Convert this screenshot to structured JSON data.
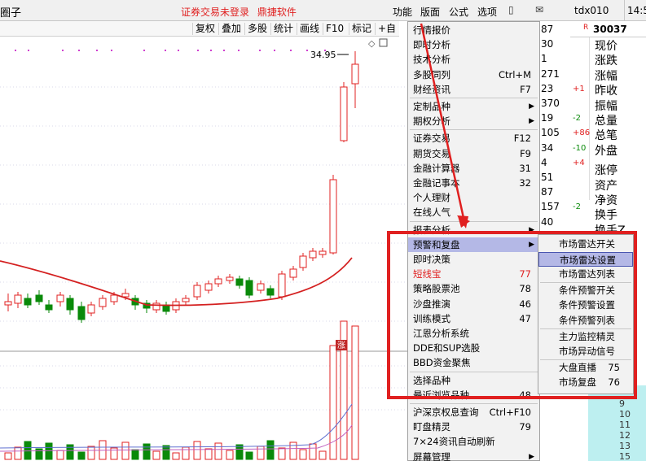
{
  "titlebar": {
    "title": "圈子",
    "status": [
      "证券交易未登录",
      "鼎捷软件"
    ],
    "menus": [
      "功能",
      "版面",
      "公式",
      "选项"
    ],
    "account": "tdx010",
    "time": "14:5"
  },
  "toolbar": [
    "复权",
    "叠加",
    "多股",
    "统计",
    "画线",
    "F10",
    "标记",
    "+自"
  ],
  "chart": {
    "high_label": "34.95",
    "badge": "涨"
  },
  "quote": {
    "code": "30037",
    "left_numbers": [
      {
        "v": "87",
        "d": ""
      },
      {
        "v": "30",
        "d": ""
      },
      {
        "v": "1",
        "d": ""
      },
      {
        "v": "271",
        "d": ""
      },
      {
        "v": "23",
        "d": "+1"
      },
      {
        "v": "370",
        "d": ""
      },
      {
        "v": "19",
        "d": "-2"
      },
      {
        "v": "105",
        "d": "+86"
      },
      {
        "v": "34",
        "d": "-10"
      },
      {
        "v": "4",
        "d": "+4"
      },
      {
        "v": "51",
        "d": ""
      },
      {
        "v": "87",
        "d": ""
      },
      {
        "v": "157",
        "d": "-2"
      },
      {
        "v": "40",
        "d": ""
      },
      {
        "v": "19",
        "d": ""
      }
    ],
    "labels": [
      "现价",
      "涨跌",
      "涨幅",
      "昨收",
      "振幅",
      "总量",
      "总笔",
      "外盘",
      "涨停",
      "资产",
      "净资",
      "换手",
      "换手Z"
    ],
    "tail_numbers": [
      "9",
      "10",
      "11",
      "12",
      "13",
      "15"
    ]
  },
  "menu": {
    "items": [
      {
        "label": "行情报价",
        "shortcut": "",
        "arrow": false
      },
      {
        "label": "即时分析",
        "shortcut": "",
        "arrow": false
      },
      {
        "label": "技术分析",
        "shortcut": "",
        "arrow": false
      },
      {
        "label": "多股同列",
        "shortcut": "Ctrl+M",
        "arrow": false
      },
      {
        "label": "财经资讯",
        "shortcut": "F7",
        "arrow": false
      },
      {
        "sep": true
      },
      {
        "label": "定制品种",
        "shortcut": "",
        "arrow": true
      },
      {
        "label": "期权分析",
        "shortcut": "",
        "arrow": true
      },
      {
        "sep": true
      },
      {
        "label": "证券交易",
        "shortcut": "F12",
        "arrow": false
      },
      {
        "label": "期货交易",
        "shortcut": "F9",
        "arrow": false
      },
      {
        "label": "金融计算器",
        "shortcut": "31",
        "arrow": false
      },
      {
        "label": "金融记事本",
        "shortcut": "32",
        "arrow": false
      },
      {
        "label": "个人理财",
        "shortcut": "",
        "arrow": false
      },
      {
        "label": "在线人气",
        "shortcut": "",
        "arrow": false
      },
      {
        "sep": true
      },
      {
        "label": "报表分析",
        "shortcut": "",
        "arrow": true
      },
      {
        "label": "预警和复盘",
        "shortcut": "",
        "arrow": true,
        "highlight": true
      },
      {
        "label": "即时决策",
        "shortcut": "",
        "arrow": false
      },
      {
        "label": "短线宝",
        "shortcut": "77",
        "arrow": false,
        "red": true
      },
      {
        "label": "策略股票池",
        "shortcut": "78",
        "arrow": false
      },
      {
        "label": "沙盘推演",
        "shortcut": "46",
        "arrow": false
      },
      {
        "label": "训练模式",
        "shortcut": "47",
        "arrow": false
      },
      {
        "label": "江恩分析系统",
        "shortcut": "",
        "arrow": false
      },
      {
        "label": "DDE和SUP选股",
        "shortcut": "",
        "arrow": false
      },
      {
        "label": "BBD资金聚焦",
        "shortcut": "",
        "arrow": false
      },
      {
        "sep": true
      },
      {
        "label": "选择品种",
        "shortcut": "",
        "arrow": false
      },
      {
        "label": "最近浏览品种",
        "shortcut": "48",
        "arrow": false
      },
      {
        "sep": true
      },
      {
        "label": "沪深京权息查询",
        "shortcut": "Ctrl+F10",
        "arrow": false
      },
      {
        "label": "盯盘精灵",
        "shortcut": "79",
        "arrow": false
      },
      {
        "label": "7×24资讯自动刷新",
        "shortcut": "",
        "arrow": false
      },
      {
        "label": "屏幕管理",
        "shortcut": "",
        "arrow": true
      }
    ]
  },
  "submenu": {
    "items": [
      {
        "label": "市场雷达开关",
        "shortcut": ""
      },
      {
        "label": "市场雷达设置",
        "shortcut": "",
        "highlight": true
      },
      {
        "label": "市场雷达列表",
        "shortcut": ""
      },
      {
        "sep": true
      },
      {
        "label": "条件预警开关",
        "shortcut": ""
      },
      {
        "label": "条件预警设置",
        "shortcut": ""
      },
      {
        "label": "条件预警列表",
        "shortcut": ""
      },
      {
        "sep": true
      },
      {
        "label": "主力监控精灵",
        "shortcut": ""
      },
      {
        "label": "市场异动信号",
        "shortcut": ""
      },
      {
        "sep": true
      },
      {
        "label": "大盘直播",
        "shortcut": "75"
      },
      {
        "label": "市场复盘",
        "shortcut": "76"
      }
    ]
  },
  "colors": {
    "up": "#e02020",
    "down": "#0a8a0a",
    "highlight": "#b4b8e6",
    "annotation": "#e02020"
  }
}
